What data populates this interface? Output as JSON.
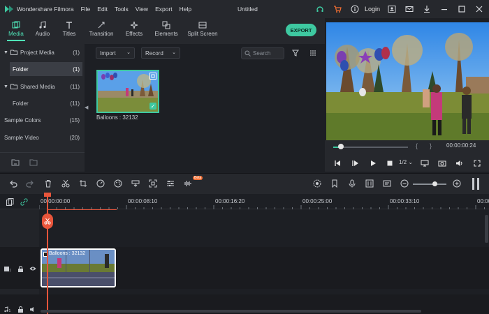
{
  "app": {
    "name": "Wondershare Filmora",
    "menu": [
      "File",
      "Edit",
      "Tools",
      "View",
      "Export",
      "Help"
    ],
    "doc_title": "Untitled",
    "login_label": "Login"
  },
  "tabs": [
    {
      "label": "Media",
      "icon": "media-icon",
      "active": true
    },
    {
      "label": "Audio",
      "icon": "music-note-icon",
      "active": false
    },
    {
      "label": "Titles",
      "icon": "text-icon",
      "active": false
    },
    {
      "label": "Transition",
      "icon": "transition-icon",
      "active": false
    },
    {
      "label": "Effects",
      "icon": "effects-icon",
      "active": false
    },
    {
      "label": "Elements",
      "icon": "elements-icon",
      "active": false
    },
    {
      "label": "Split Screen",
      "icon": "split-screen-icon",
      "active": false
    }
  ],
  "export_label": "EXPORT",
  "sidebar": {
    "items": [
      {
        "label": "Project Media",
        "count": "(1)"
      },
      {
        "label": "Folder",
        "count": "(1)",
        "selected": true
      },
      {
        "label": "Shared Media",
        "count": "(11)"
      },
      {
        "label": "Folder",
        "count": "(11)"
      },
      {
        "label": "Sample Colors",
        "count": "(15)"
      },
      {
        "label": "Sample Video",
        "count": "(20)"
      }
    ]
  },
  "media": {
    "import_label": "Import",
    "record_label": "Record",
    "search_placeholder": "Search",
    "clip_label": "Balloons : 32132"
  },
  "preview": {
    "timecode": "00:00:00:24",
    "speed": "1/2",
    "progress": 0.1
  },
  "toolbar": {
    "beta_label": "Beta"
  },
  "timeline": {
    "ruler_labels": [
      "00:00:00:00",
      "00:00:08:10",
      "00:00:16:20",
      "00:00:25:00",
      "00:00:33:10",
      "00:00:4"
    ],
    "clip_label": "Balloons : 32132"
  },
  "colors": {
    "accent": "#3ec9a1",
    "playhead": "#e8553b",
    "background": "#1d1f24",
    "panel": "#26282d"
  }
}
